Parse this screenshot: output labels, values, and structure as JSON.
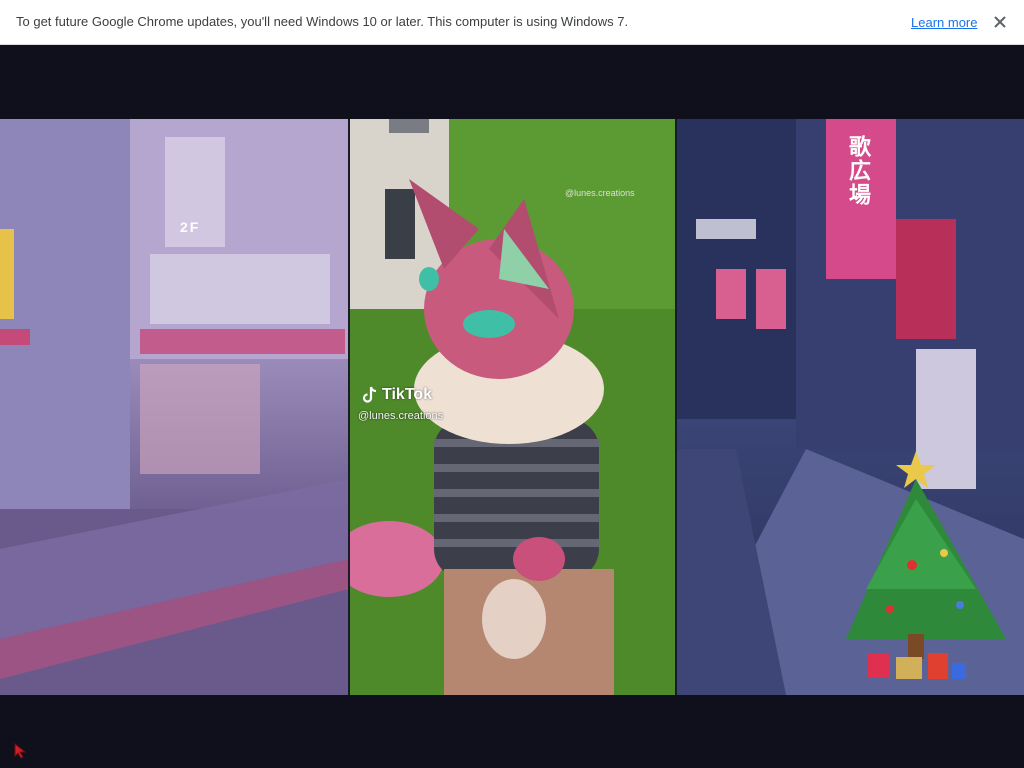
{
  "infobar": {
    "message": "To get future Google Chrome updates, you'll need Windows 10 or later. This computer is using Windows 7.",
    "learn_more": "Learn more",
    "close_icon": "close-icon"
  },
  "video": {
    "tiktok_logo": "TikTok",
    "tiktok_handle": "@lunes.creations",
    "tiktok_handle_top": "@lunes.creations",
    "left_sign": "2F",
    "right_sign": "歌広場"
  },
  "colors": {
    "background": "#0f101c",
    "link": "#1a73e8"
  }
}
